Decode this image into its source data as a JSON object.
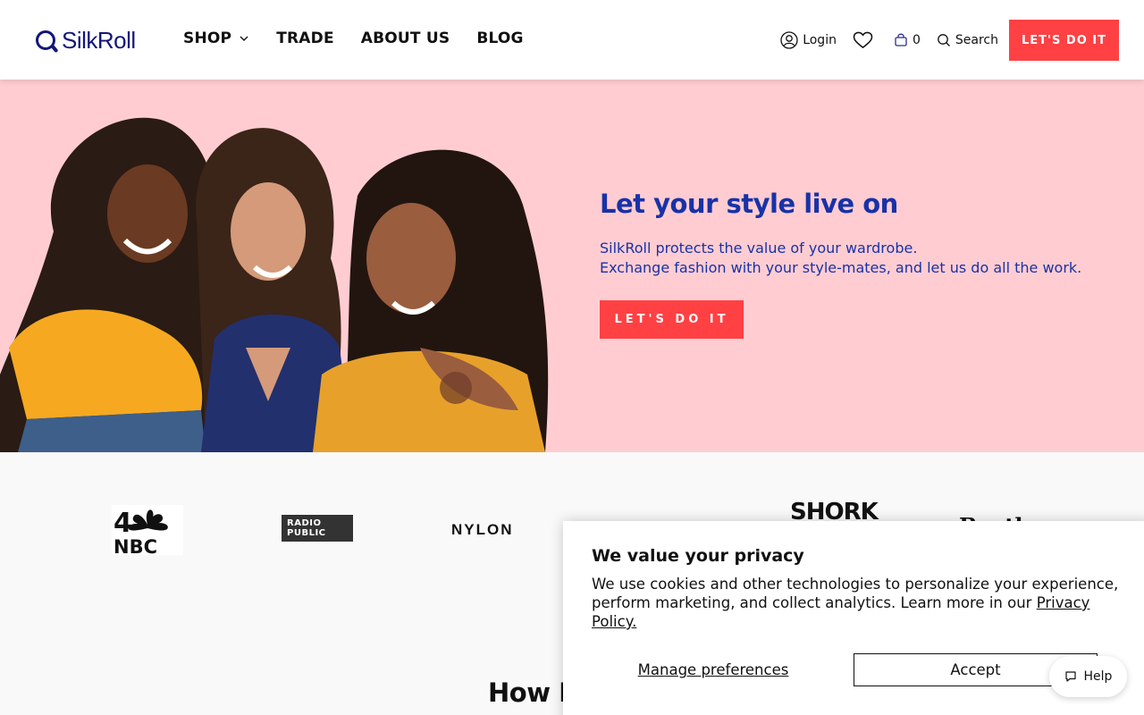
{
  "header": {
    "logo_text": "SilkRoll",
    "nav": [
      {
        "label": "SHOP",
        "has_dropdown": true
      },
      {
        "label": "TRADE"
      },
      {
        "label": "ABOUT US"
      },
      {
        "label": "BLOG"
      }
    ],
    "login_label": "Login",
    "cart_count": "0",
    "search_label": "Search",
    "cta_label": "LET'S DO IT"
  },
  "hero": {
    "title": "Let your style live on",
    "subtitle_line1": "SilkRoll protects the value of your wardrobe.",
    "subtitle_line2": "Exchange fashion with your style-mates, and let us do all the work.",
    "cta_label": "LET'S DO IT"
  },
  "press": {
    "nbc_line1": "4",
    "nbc_line2": "NBC",
    "radio_public": "RADIO PUBLIC",
    "nylon": "NYLON",
    "shork": "SHORK",
    "bustle": "Bustle"
  },
  "section": {
    "how_title": "How It"
  },
  "cookie": {
    "title": "We value your privacy",
    "body": "We use cookies and other technologies to personalize your experience, perform marketing, and collect analytics. Learn more in our ",
    "link": "Privacy Policy.",
    "manage_label": "Manage preferences",
    "accept_label": "Accept"
  },
  "help": {
    "label": "Help"
  },
  "colors": {
    "brand_navy": "#14167a",
    "hero_bg": "#ffcdd1",
    "hero_text": "#1832a8",
    "cta": "#ff4144"
  }
}
